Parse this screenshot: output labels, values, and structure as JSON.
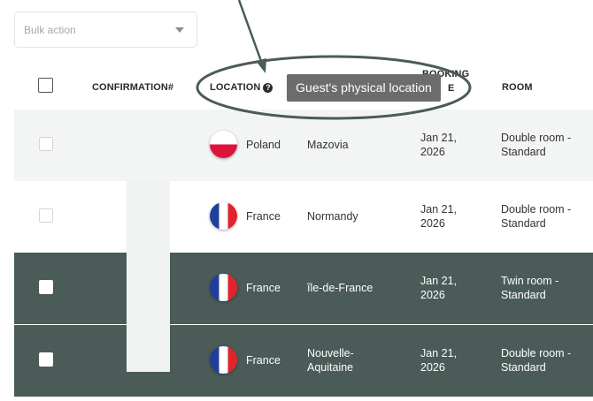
{
  "bulk_action": {
    "placeholder": "Bulk action"
  },
  "table": {
    "columns": {
      "confirmation": "CONFIRMATION#",
      "location": "LOCATION",
      "booking_line1": "BOOKING",
      "booking_line2": "E",
      "room": "ROOM"
    },
    "location_help_glyph": "?",
    "rows": [
      {
        "flag": "poland-flag-icon",
        "country": "Poland",
        "region_line1": "Mazovia",
        "region_line2": "",
        "date_line1": "Jan 21,",
        "date_line2": "2026",
        "room_line1": "Double room -",
        "room_line2": "Standard",
        "selected": false
      },
      {
        "flag": "france-flag-icon",
        "country": "France",
        "region_line1": "Normandy",
        "region_line2": "",
        "date_line1": "Jan 21,",
        "date_line2": "2026",
        "room_line1": "Double room -",
        "room_line2": "Standard",
        "selected": false
      },
      {
        "flag": "france-flag-icon",
        "country": "France",
        "region_line1": "île-de-France",
        "region_line2": "",
        "date_line1": "Jan 21,",
        "date_line2": "2026",
        "room_line1": "Twin room -",
        "room_line2": "Standard",
        "selected": true
      },
      {
        "flag": "france-flag-icon",
        "country": "France",
        "region_line1": "Nouvelle-",
        "region_line2": "Aquitaine",
        "date_line1": "Jan 21,",
        "date_line2": "2026",
        "room_line1": "Double room -",
        "room_line2": "Standard",
        "selected": true
      }
    ]
  },
  "tooltip": {
    "text": "Guest's physical location"
  },
  "colors": {
    "selected_row": "#4a5b58",
    "annotation_stroke": "#4a5b58",
    "tooltip_bg": "#6c6c6c",
    "alt_row": "#f3f4f4"
  }
}
